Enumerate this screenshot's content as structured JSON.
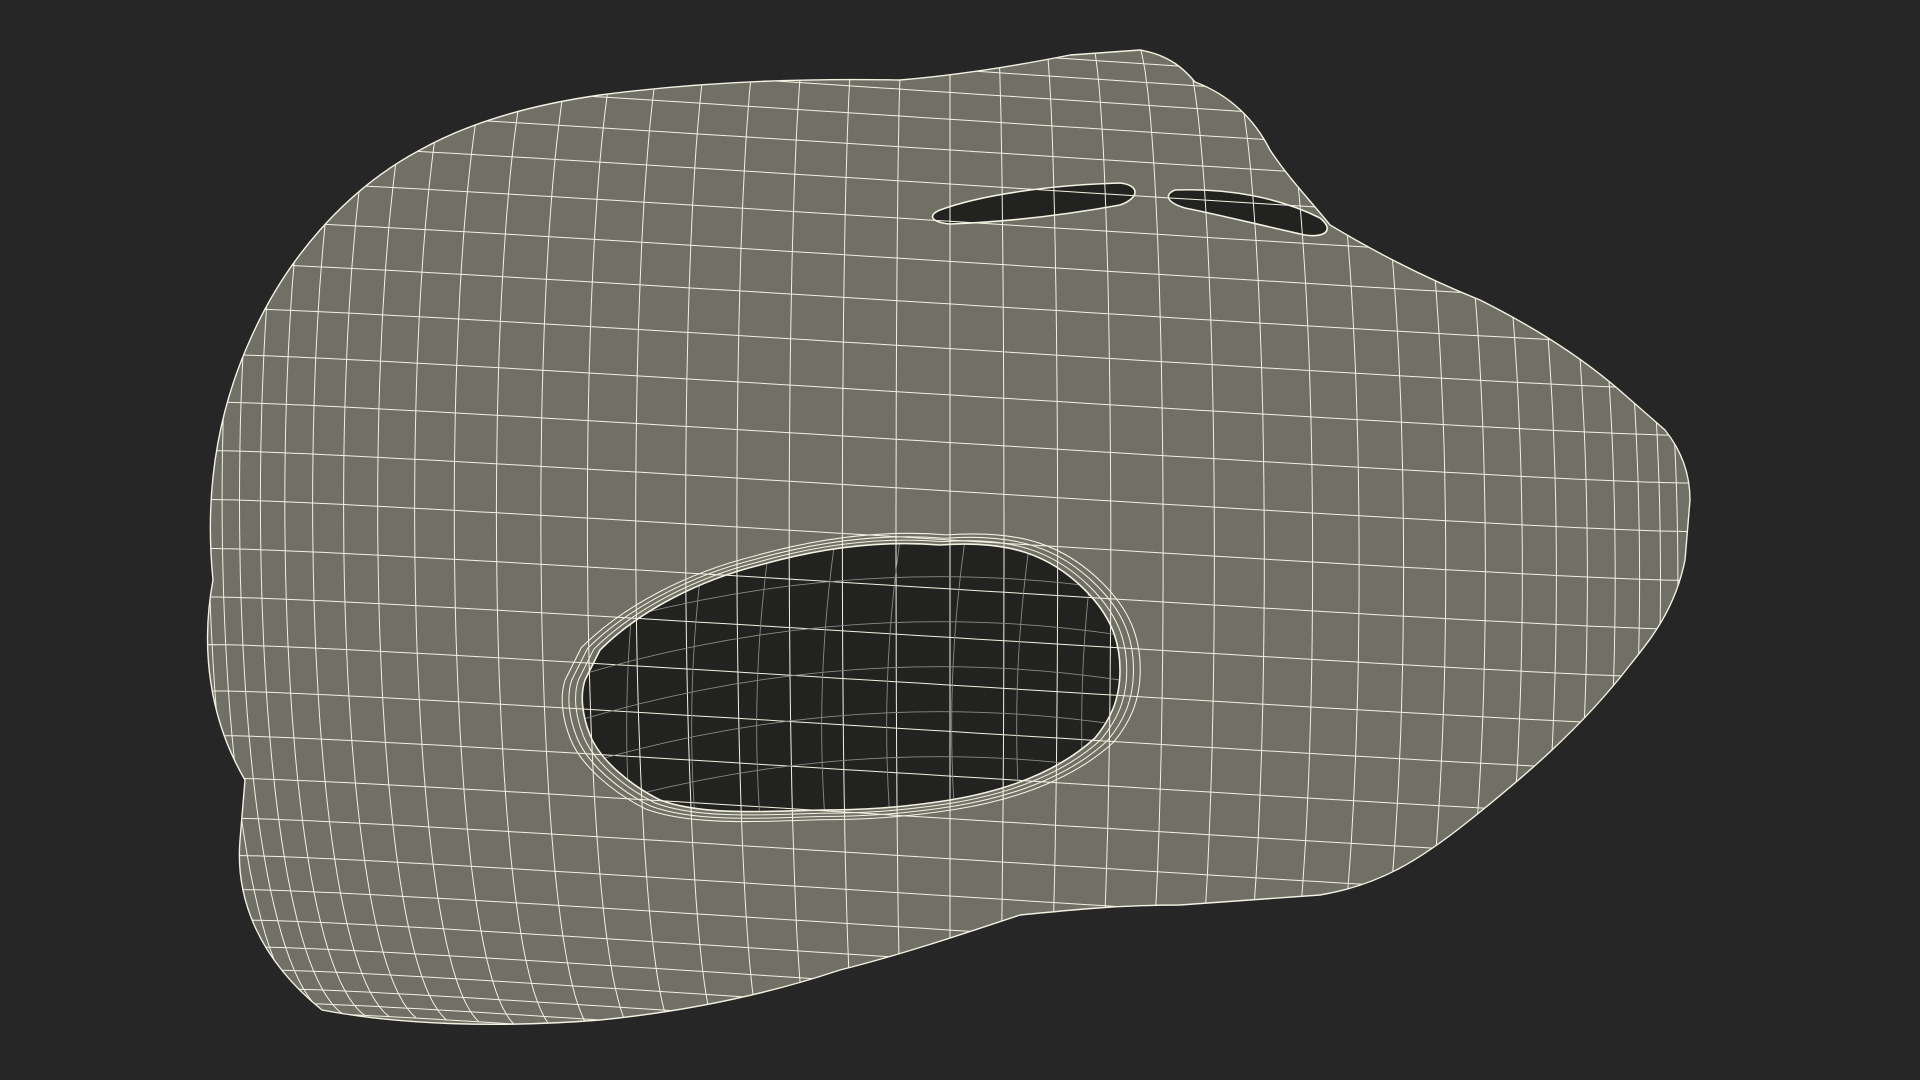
{
  "viewport": {
    "background_color": "#262626",
    "model": {
      "name": "mask-mesh",
      "surface_color": "#707066",
      "wire_color": "#f3f1e2",
      "inner_wire_color": "#8a8a86",
      "cavity_color": "#222221",
      "display_mode": "wireframe-on-shaded"
    }
  }
}
